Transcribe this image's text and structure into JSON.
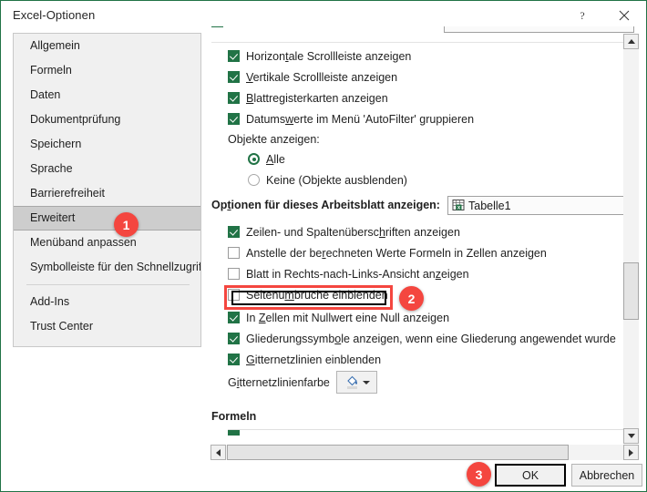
{
  "window": {
    "title": "Excel-Optionen",
    "help_icon": "help-question-icon",
    "close_icon": "close-icon"
  },
  "sidebar": {
    "items": [
      {
        "label": "Allgemein",
        "selected": false
      },
      {
        "label": "Formeln",
        "selected": false
      },
      {
        "label": "Daten",
        "selected": false
      },
      {
        "label": "Dokumentprüfung",
        "selected": false
      },
      {
        "label": "Speichern",
        "selected": false
      },
      {
        "label": "Sprache",
        "selected": false
      },
      {
        "label": "Barrierefreiheit",
        "selected": false
      },
      {
        "label": "Erweitert",
        "selected": true
      },
      {
        "label": "Menüband anpassen",
        "selected": false
      },
      {
        "label": "Symbolleiste für den Schnellzugriff",
        "selected": false
      },
      {
        "label": "Add-Ins",
        "selected": false
      },
      {
        "label": "Trust Center",
        "selected": false
      }
    ]
  },
  "content": {
    "clipped_top_row_label": "",
    "display_options": [
      {
        "label": "Horizontale Scrolleiste anzeigen",
        "text_a": "Horizon",
        "accel": "t",
        "text_b": "ale Scrollleiste anzeigen",
        "checked": true
      },
      {
        "label": "Vertikale Scrollleiste anzeigen",
        "text_a": "",
        "accel": "V",
        "text_b": "ertikale Scrollleiste anzeigen",
        "checked": true
      },
      {
        "label": "Blattregisterkarten anzeigen",
        "text_a": "",
        "accel": "B",
        "text_b": "lattregisterkarten anzeigen",
        "checked": true
      },
      {
        "label": "Datumswerte im Menü 'AutoFilter' gruppieren",
        "text_a": "Datums",
        "accel": "w",
        "text_b": "erte im Menü 'AutoFilter' gruppieren",
        "checked": true
      }
    ],
    "objects_group_label": "Objekte anzeigen:",
    "objects_radios": [
      {
        "label": "Alle",
        "text_a": "",
        "accel": "A",
        "text_b": "lle",
        "selected": true
      },
      {
        "label": "Keine (Objekte ausblenden)",
        "text_a": "Keine (Ob",
        "accel": "j",
        "text_b": "ekte ausblenden)",
        "selected": false
      }
    ],
    "worksheet_section_label": "Optionen für dieses Arbeitsblatt anzeigen:",
    "worksheet_section_accel": "t",
    "worksheet_section_a": "Op",
    "worksheet_section_b": "ionen für dieses Arbeitsblatt anzeigen:",
    "worksheet_combo_value": "Tabelle1",
    "worksheet_combo_icon": "worksheet-icon",
    "worksheet_options": [
      {
        "label": "Zeilen- und Spaltenüberschriften anzeigen",
        "text_a": "Zeilen- und Spaltenübersc",
        "accel": "h",
        "text_b": "riften anzeigen",
        "checked": true,
        "highlighted": false
      },
      {
        "label": "Anstelle der berechneten Werte Formeln in Zellen anzeigen",
        "text_a": "Anstelle der be",
        "accel": "r",
        "text_b": "echneten Werte Formeln in Zellen anzeigen",
        "checked": false,
        "highlighted": false
      },
      {
        "label": "Blatt in Rechts-nach-Links-Ansicht anzeigen",
        "text_a": "Blatt in Rechts-nach-Links-Ansicht an",
        "accel": "z",
        "text_b": "eigen",
        "checked": false,
        "highlighted": false
      },
      {
        "label": "Seitenumbrüche einblenden",
        "text_a": "Seitenu",
        "accel": "m",
        "text_b": "brüche einblenden",
        "checked": false,
        "highlighted": true
      },
      {
        "label": "In Zellen mit Nullwert eine Null anzeigen",
        "text_a": "In ",
        "accel": "Z",
        "text_b": "ellen mit Nullwert eine Null anzeigen",
        "checked": true,
        "highlighted": false
      },
      {
        "label": "Gliederungssymbole anzeigen, wenn eine Gliederung angewendet wurde",
        "text_a": "Gliederungssymb",
        "accel": "o",
        "text_b": "le anzeigen, wenn eine Gliederung angewendet wurde",
        "checked": true,
        "highlighted": false
      },
      {
        "label": "Gitternetzlinien einblenden",
        "text_a": "",
        "accel": "G",
        "text_b": "itternetzlinien einblenden",
        "checked": true,
        "highlighted": false
      }
    ],
    "gridcolor_label": "Gitternetzlinienfarbe",
    "gridcolor_label_a": "G",
    "gridcolor_label_accel": "i",
    "gridcolor_label_b": "tternetzlinienfarbe",
    "gridcolor_button_icon": "fill-color-icon",
    "gridcolor_caret_icon": "chevron-down-icon",
    "formulas_section_label": "Formeln"
  },
  "scrollbars": {
    "vertical": {
      "up_icon": "triangle-up-icon",
      "down_icon": "triangle-down-icon",
      "thumb": "vertical-scroll-thumb"
    },
    "horizontal": {
      "left_icon": "triangle-left-icon",
      "right_icon": "triangle-right-icon",
      "thumb": "horizontal-scroll-thumb"
    }
  },
  "footer": {
    "ok_label": "OK",
    "cancel_label": "Abbrechen"
  },
  "annotations": {
    "badges": [
      {
        "number": "1"
      },
      {
        "number": "2"
      },
      {
        "number": "3"
      }
    ],
    "accent_color": "#f4463f",
    "highlight_target": "Seitenumbrüche einblenden"
  },
  "colors": {
    "excel_green": "#217346",
    "callout_red": "#f4463f",
    "selected_nav": "#cdcdcd"
  }
}
